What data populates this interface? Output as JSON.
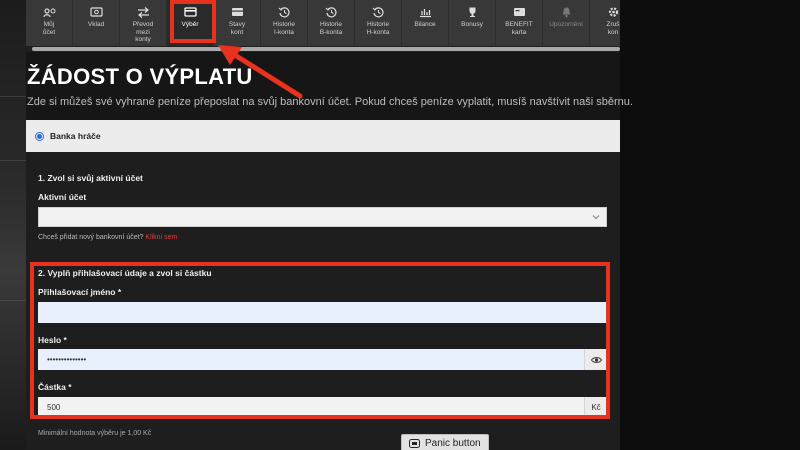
{
  "toolbar": {
    "items": [
      {
        "label": "Můj\nůčet",
        "icon": "user-gear-icon",
        "active": false,
        "disabled": false
      },
      {
        "label": "Vklad",
        "icon": "cash-icon",
        "active": false,
        "disabled": false
      },
      {
        "label": "Převod\nmezi\nkonty",
        "icon": "transfer-arrows-icon",
        "active": false,
        "disabled": false
      },
      {
        "label": "Výběr",
        "icon": "card-icon",
        "active": true,
        "disabled": false
      },
      {
        "label": "Stavy\nkont",
        "icon": "wallet-icon",
        "active": false,
        "disabled": false
      },
      {
        "label": "Historie\nI-konta",
        "icon": "history-icon",
        "active": false,
        "disabled": false
      },
      {
        "label": "Historie\nB-konta",
        "icon": "history-icon",
        "active": false,
        "disabled": false
      },
      {
        "label": "Historie\nH-konta",
        "icon": "history-icon",
        "active": false,
        "disabled": false
      },
      {
        "label": "Bilance",
        "icon": "bar-chart-icon",
        "active": false,
        "disabled": false
      },
      {
        "label": "Bonusy",
        "icon": "trophy-icon",
        "active": false,
        "disabled": false
      },
      {
        "label": "BENEFIT\nkarta",
        "icon": "benefit-card-icon",
        "active": false,
        "disabled": false
      },
      {
        "label": "Upozornění",
        "icon": "bell-icon",
        "active": false,
        "disabled": true
      },
      {
        "label": "Zruš\nkon",
        "icon": "gear-icon",
        "active": false,
        "disabled": false
      }
    ]
  },
  "main": {
    "title": "ŽÁDOST O VÝPLATU",
    "subtitle": "Zde si můžeš své vyhrané peníze přeposlat na svůj bankovní účet. Pokud chceš peníze vyplatit, musíš navštívit naši sběrnu.",
    "bank_option_label": "Banka hráče",
    "section1_title": "1. Zvol si svůj aktivní účet",
    "active_account_label": "Aktivní účet",
    "active_account_value": "",
    "add_account_text": "Chceš přidat nový bankovní účet?",
    "add_account_link": "Klikni sem",
    "section2_title": "2. Vyplň přihlašovací údaje a zvol si částku",
    "login_label": "Přihlašovací jméno *",
    "login_value": "",
    "password_label": "Heslo *",
    "password_value": "••••••••••••••",
    "amount_label": "Částka *",
    "amount_value": "500",
    "amount_currency": "Kč",
    "min_note": "Minimální hodnota výběru je 1,00 Kč",
    "panic_button": "Panic button"
  },
  "colors": {
    "annotation_red": "#e8321e",
    "link_red": "#e23b3b",
    "radio_blue": "#2d6fd6"
  }
}
